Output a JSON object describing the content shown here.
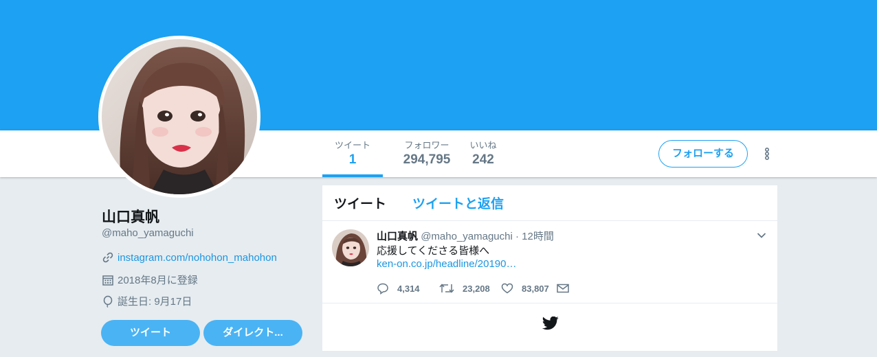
{
  "profile": {
    "name": "山口真帆",
    "handle": "@maho_yamaguchi",
    "link": "instagram.com/nohohon_mahohon",
    "joined": "2018年8月に登録",
    "birthday": "誕生日: 9月17日"
  },
  "stats": [
    {
      "label": "ツイート",
      "value": "1"
    },
    {
      "label": "フォロワー",
      "value": "294,795"
    },
    {
      "label": "いいね",
      "value": "242"
    }
  ],
  "follow_label": "フォローする",
  "side_buttons": {
    "tweet": "ツイート",
    "dm": "ダイレクト..."
  },
  "tabs": {
    "tweets": "ツイート",
    "replies": "ツイートと返信"
  },
  "tweet": {
    "name": "山口真帆",
    "handle": "@maho_yamaguchi",
    "sep": "·",
    "time": "12時間",
    "text": "応援してくださる皆様へ",
    "link": "ken-on.co.jp/headline/20190…",
    "replies": "4,314",
    "retweets": "23,208",
    "likes": "83,807"
  },
  "colors": {
    "brand": "#1da1f2",
    "link": "#1b95e0",
    "background": "#e6ecf0",
    "muted": "#657786"
  },
  "icons": [
    "link-icon",
    "calendar-icon",
    "balloon-icon",
    "reply-icon",
    "retweet-icon",
    "heart-icon",
    "mail-icon",
    "twitter-bird-icon",
    "more-icon",
    "chevron-down-icon"
  ]
}
